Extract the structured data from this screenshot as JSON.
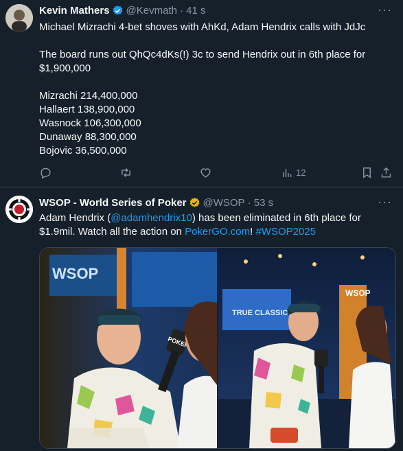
{
  "tweets": [
    {
      "author": "Kevin Mathers",
      "handle": "@Kevmath",
      "time": "· 41 s",
      "lines": [
        "Michael Mizrachi 4-bet shoves with AhKd, Adam Hendrix calls with JdJc",
        "",
        "The board runs out QhQc4dKs(!) 3c to send Hendrix out in 6th place for",
        "$1,900,000",
        "",
        "Mizrachi 214,400,000",
        "Hallaert 138,900,000",
        "Wasnock 106,300,000",
        "Dunaway 88,300,000",
        "Bojovic 36,500,000"
      ],
      "views": "12",
      "badge_color": "#1d9bf0"
    },
    {
      "author": "WSOP - World Series of Poker",
      "handle": "@WSOP",
      "time": "· 53 s",
      "text": {
        "l1_a": "Adam Hendrix (",
        "l1_mention": "@adamhendrix10",
        "l1_b": ") has been eliminated in 6th place for",
        "l2_a": "$1.9mil. Watch all the action on ",
        "l2_link": "PokerGO.com",
        "l2_b": "! ",
        "l2_hashtag": "#WSOP2025"
      },
      "badge_color": "#e2b719"
    }
  ],
  "icons": {
    "more": "more-icon",
    "reply": "reply-icon",
    "retweet": "retweet-icon",
    "like": "like-icon",
    "views": "views-icon",
    "bookmark": "bookmark-icon",
    "share": "share-icon"
  },
  "colors": {
    "background": "#15202b",
    "text": "#f7f9f9",
    "secondary": "#8b98a5",
    "link": "#1d9bf0",
    "divider": "#38444d"
  },
  "photo_text": {
    "sign_left": "WSOP",
    "sign_right": "WSOP",
    "tag_p1": "POKER",
    "screen_p2": "TRUE CLASSIC"
  }
}
